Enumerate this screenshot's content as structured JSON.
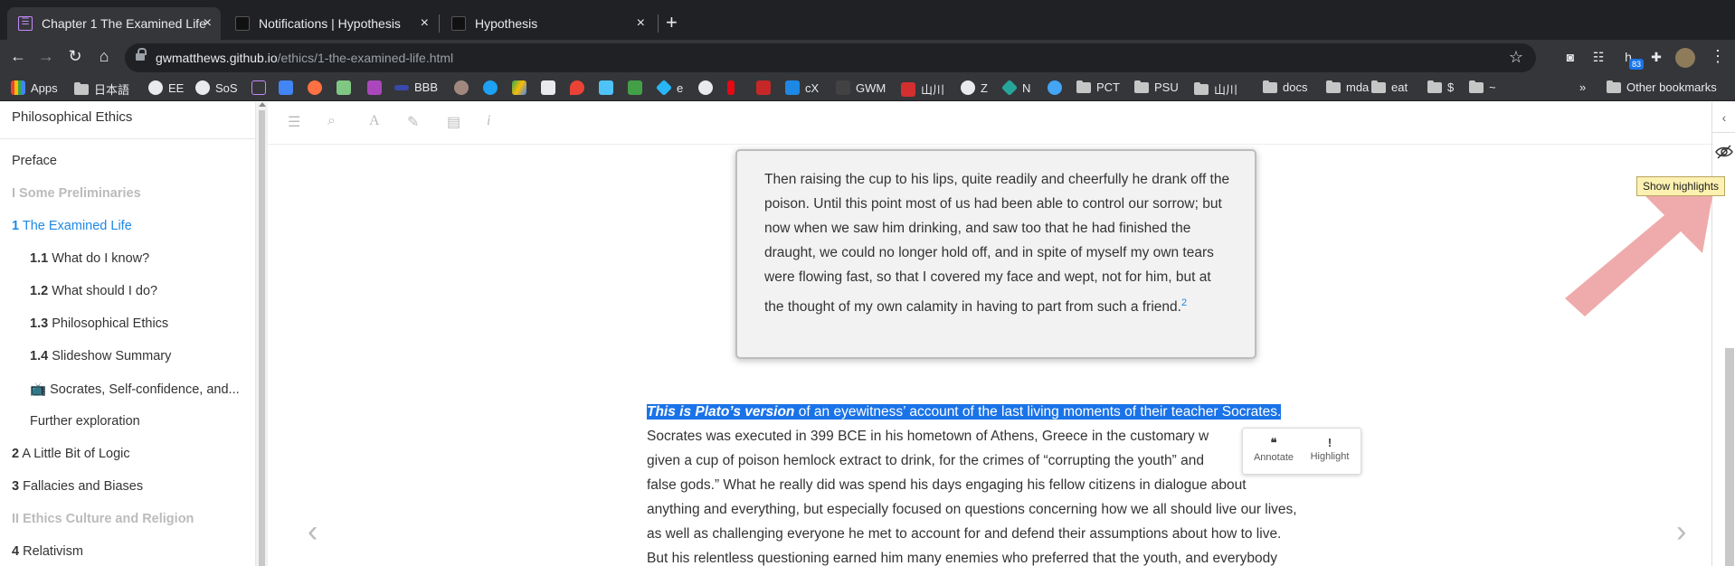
{
  "tabs": [
    {
      "title": "Chapter 1 The Examined Life |",
      "active": true
    },
    {
      "title": "Notifications | Hypothesis",
      "active": false
    },
    {
      "title": "Hypothesis",
      "active": false
    }
  ],
  "tab_close_glyph": "×",
  "new_tab_glyph": "+",
  "address": {
    "host": "gwmatthews.github.io",
    "path": "/ethics/1-the-examined-life.html"
  },
  "extension_badge": "83",
  "bookmarks": [
    {
      "label": "Apps",
      "icon": "apps-grid-icon"
    },
    {
      "label": "日本語",
      "icon": "folder-icon"
    },
    {
      "label": "EE",
      "icon": "globe-icon"
    },
    {
      "label": "SoS",
      "icon": "globe-icon"
    },
    {
      "label": "BBB",
      "icon": "bbb-icon"
    },
    {
      "label": "e",
      "icon": "site-icon"
    },
    {
      "label": "cX",
      "icon": "site-icon"
    },
    {
      "label": "GWM",
      "icon": "site-icon"
    },
    {
      "label": "山川",
      "icon": "site-icon"
    },
    {
      "label": "Z",
      "icon": "globe-icon"
    },
    {
      "label": "N",
      "icon": "site-icon"
    },
    {
      "label": "PCT",
      "icon": "folder-icon"
    },
    {
      "label": "PSU",
      "icon": "folder-icon"
    },
    {
      "label": "山川",
      "icon": "folder-icon"
    },
    {
      "label": "docs",
      "icon": "folder-icon"
    },
    {
      "label": "mda",
      "icon": "folder-icon"
    },
    {
      "label": "eat",
      "icon": "folder-icon"
    },
    {
      "label": "$",
      "icon": "folder-icon"
    },
    {
      "label": "~",
      "icon": "folder-icon"
    }
  ],
  "bookmarks_overflow": "»",
  "other_bookmarks": "Other bookmarks",
  "sidebar": {
    "book_title": "Philosophical Ethics",
    "toc": [
      {
        "num": "",
        "label": "Preface",
        "kind": "chapter"
      },
      {
        "num": "",
        "label": "I Some Preliminaries",
        "kind": "part"
      },
      {
        "num": "1",
        "label": "The Examined Life",
        "kind": "active"
      },
      {
        "num": "1.1",
        "label": "What do I know?",
        "kind": "section"
      },
      {
        "num": "1.2",
        "label": "What should I do?",
        "kind": "section"
      },
      {
        "num": "1.3",
        "label": "Philosophical Ethics",
        "kind": "section"
      },
      {
        "num": "1.4",
        "label": "Slideshow Summary",
        "kind": "section"
      },
      {
        "num": "",
        "label": "📺 Socrates, Self-confidence, and...",
        "kind": "section"
      },
      {
        "num": "",
        "label": "Further exploration",
        "kind": "section"
      },
      {
        "num": "2",
        "label": "A Little Bit of Logic",
        "kind": "chapter"
      },
      {
        "num": "3",
        "label": "Fallacies and Biases",
        "kind": "chapter"
      },
      {
        "num": "",
        "label": "II Ethics Culture and Religion",
        "kind": "part"
      },
      {
        "num": "4",
        "label": "Relativism",
        "kind": "chapter"
      }
    ]
  },
  "quote": {
    "text": "Then raising the cup to his lips, quite readily and cheerfully he drank off the poison. Until this point most of us had been able to control our sorrow; but now when we saw him drinking, and saw too that he had finished the draught, we could no longer hold off, and in spite of myself my own tears were flowing fast, so that I covered my face and wept, not for him, but at the thought of my own calamity in having to part from such a friend.",
    "footnote": "2"
  },
  "paragraph": {
    "lead_emph": "This is Plato’s version",
    "lead_rest": " of an eyewitness’ account of the last living moments of their teacher Socrates.",
    "lines": [
      "Socrates was executed in 399 BCE in his hometown of Athens, Greece in the customary w",
      "given a cup of poison hemlock extract to drink, for the crimes of “corrupting the youth” and",
      "false gods.” What he really did was spend his days engaging his fellow citizens in dialogue about",
      "anything and everything, but especially focused on questions concerning how we all should live our lives,",
      "as well as challenging everyone he met to account for and defend their assumptions about how to live.",
      "But his relentless questioning earned him many enemies who preferred that the youth, and everybody"
    ]
  },
  "adder": {
    "annotate": "Annotate",
    "highlight": "Highlight"
  },
  "tooltip": "Show highlights",
  "colors": {
    "accent": "#1e88e5",
    "selection": "#1a73e8",
    "arrow": "#e57373"
  }
}
